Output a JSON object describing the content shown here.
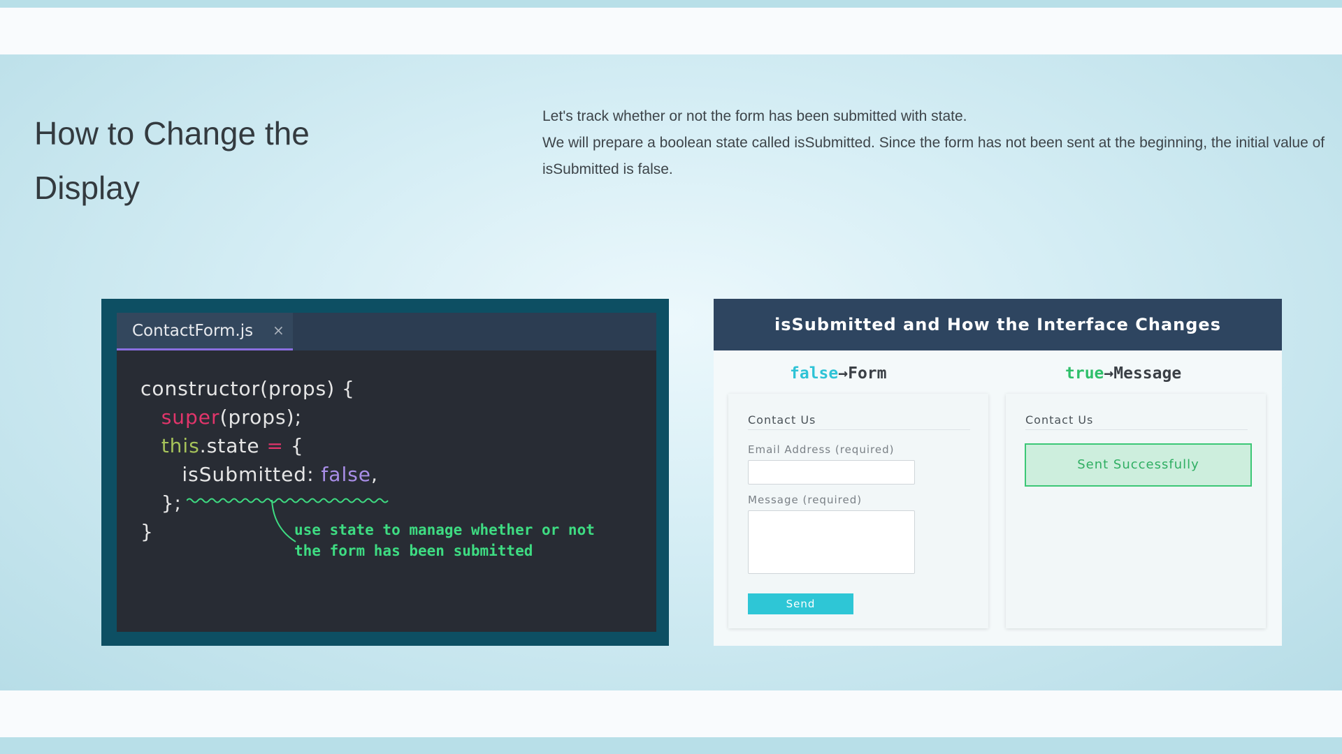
{
  "page": {
    "title": "How to Change the Display",
    "description": [
      "Let's track whether or not the form has been submitted with state.",
      "We will prepare a boolean state called isSubmitted. Since the form has not been sent at the beginning, the initial value of isSubmitted is false."
    ]
  },
  "code_editor": {
    "tab_name": "ContactForm.js",
    "close_glyph": "×",
    "lines": {
      "l1": "constructor(props) {",
      "l2_super": "super",
      "l2_rest": "(props);",
      "l3_this": "this",
      "l3_mid": ".state ",
      "l3_eq": "=",
      "l3_brace": " {",
      "l4_key": "isSubmitted: ",
      "l4_val": "false",
      "l4_comma": ",",
      "l5": "};",
      "l6": "}"
    },
    "callout": [
      "use state to manage whether or not",
      "the form has been submitted"
    ],
    "colors": {
      "super": "#e2356b",
      "this": "#a6c35a",
      "false": "#a98ee8",
      "callout": "#3edc82",
      "tab_underline": "#8a6fe0"
    }
  },
  "illustration": {
    "header": "isSubmitted and How the Interface Changes",
    "left": {
      "state": "false",
      "arrow": "→",
      "target": "Form",
      "card_title": "Contact Us",
      "email_label": "Email Address (required)",
      "email_value": "",
      "message_label": "Message (required)",
      "message_value": "",
      "send_label": "Send"
    },
    "right": {
      "state": "true",
      "arrow": "→",
      "target": "Message",
      "card_title": "Contact Us",
      "success_text": "Sent Successfully"
    },
    "colors": {
      "header_bg": "#2e4560",
      "false": "#2ec3d6",
      "true": "#2fbf6a",
      "send_bg": "#2ec6d6",
      "success_border": "#3cc776"
    }
  }
}
